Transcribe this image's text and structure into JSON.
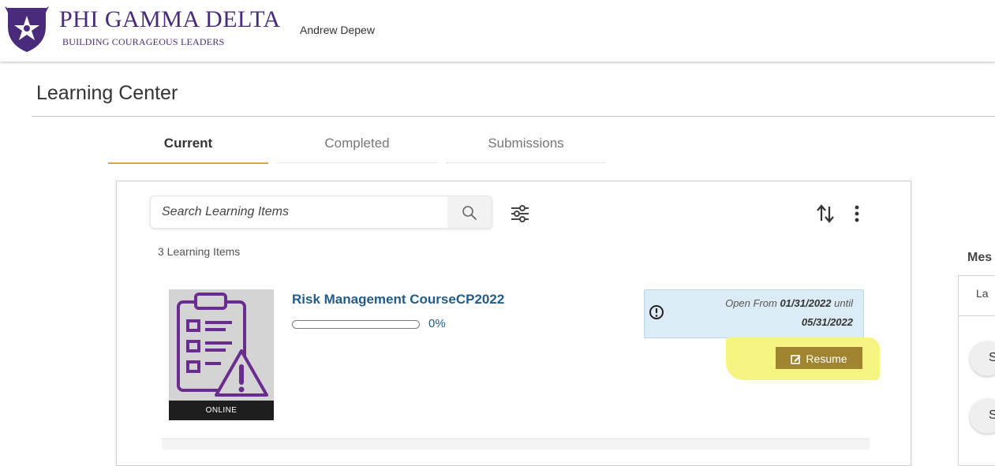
{
  "header": {
    "brand_name": "PHI GAMMA DELTA",
    "brand_tagline": "BUILDING COURAGEOUS LEADERS",
    "user_name": "Andrew Depew",
    "brand_color": "#4a2a7a"
  },
  "page": {
    "title": "Learning Center"
  },
  "tabs": [
    {
      "label": "Current",
      "active": true
    },
    {
      "label": "Completed",
      "active": false
    },
    {
      "label": "Submissions",
      "active": false
    }
  ],
  "toolbar": {
    "search_placeholder": "Search Learning Items",
    "search_icon": "search-icon",
    "filter_icon": "filter-sliders-icon",
    "sort_icon": "sort-icon",
    "more_icon": "more-vertical-icon"
  },
  "list": {
    "count_label": "3 Learning Items",
    "items": [
      {
        "title": "Risk Management CourseCP2022",
        "progress": 0,
        "progress_label": "0%",
        "type_tag": "ONLINE",
        "open_prefix": "Open From ",
        "open_start": "01/31/2022",
        "open_mid": " until",
        "open_end": "05/31/2022",
        "action_label": "Resume",
        "thumbnail_icon": "clipboard-warning-icon"
      }
    ]
  },
  "messages": {
    "heading": "Mes",
    "tab_label": "La",
    "circle_1": "S",
    "circle_2": "S"
  },
  "colors": {
    "accent_tab": "#e6a04a",
    "link": "#1f5c8c",
    "resume_button": "#a18430",
    "info_box": "#dcecf7",
    "highlight": "#f6f37a"
  }
}
